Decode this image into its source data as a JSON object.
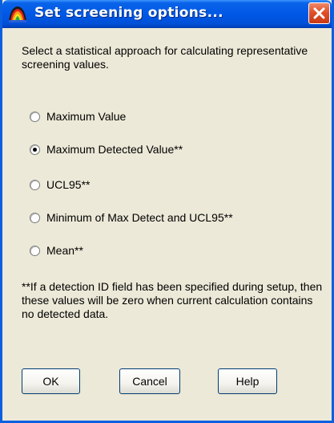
{
  "window": {
    "title": "Set screening options..."
  },
  "dialog": {
    "instruction": "Select a statistical approach for calculating representative screening values.",
    "options": [
      {
        "label": "Maximum Value",
        "checked": false
      },
      {
        "label": "Maximum Detected Value**",
        "checked": true
      },
      {
        "label": "UCL95**",
        "checked": false
      },
      {
        "label": "Minimum of Max Detect and UCL95**",
        "checked": false
      },
      {
        "label": "Mean**",
        "checked": false
      }
    ],
    "note": "**If a detection ID field has been specified during setup, then these values will be zero when current calculation contains no detected data."
  },
  "buttons": {
    "ok": "OK",
    "cancel": "Cancel",
    "help": "Help"
  },
  "icons": {
    "app": "app-icon",
    "close": "close-icon"
  },
  "colors": {
    "titlebar": "#0058e6",
    "window_bg": "#ece9d8",
    "close_button": "#e0502a"
  }
}
